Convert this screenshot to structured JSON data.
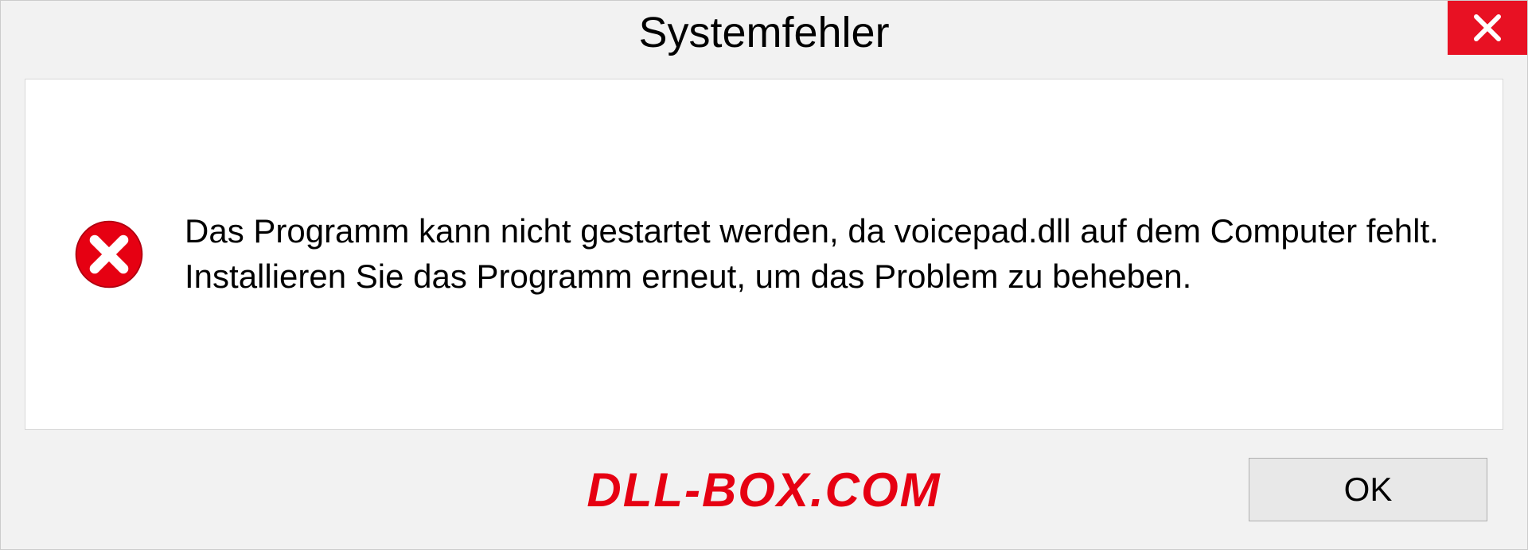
{
  "dialog": {
    "title": "Systemfehler",
    "message": "Das Programm kann nicht gestartet werden, da voicepad.dll auf dem Computer fehlt. Installieren Sie das Programm erneut, um das Problem zu beheben.",
    "ok_label": "OK"
  },
  "watermark": "DLL-BOX.COM"
}
